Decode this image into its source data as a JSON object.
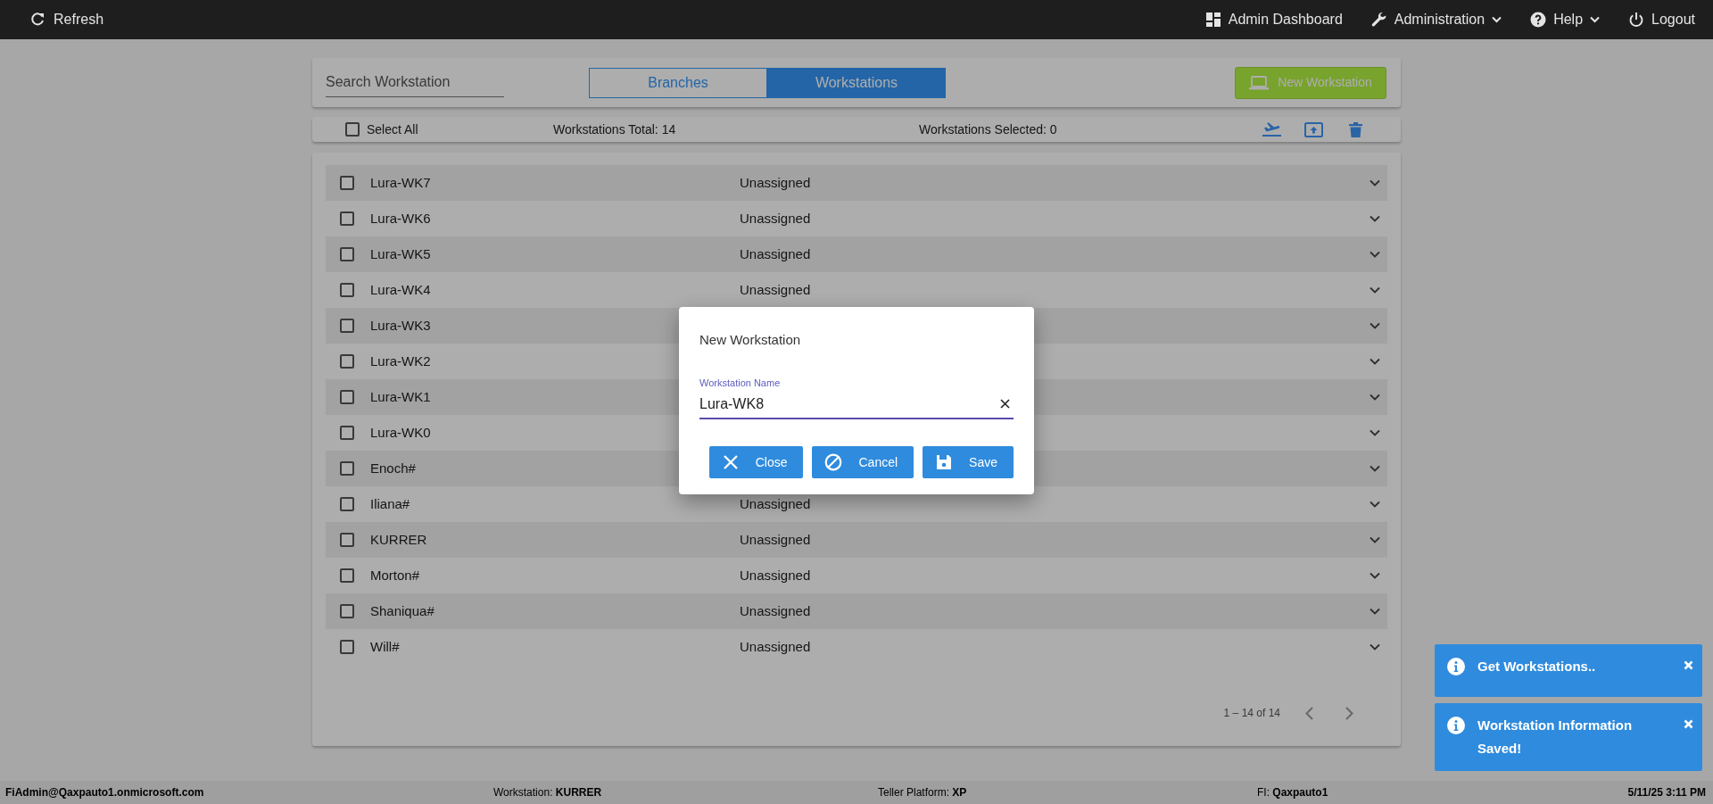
{
  "top_bar": {
    "left": [
      {
        "label": "Refresh",
        "kind": "refresh",
        "dropdown": false
      }
    ],
    "right": [
      {
        "label": "Admin Dashboard",
        "kind": "dashboard",
        "dropdown": false
      },
      {
        "label": "Administration",
        "kind": "wrench",
        "dropdown": true
      },
      {
        "label": "Help",
        "kind": "help",
        "dropdown": true
      },
      {
        "label": "Logout",
        "kind": "power",
        "dropdown": false
      }
    ]
  },
  "search": {
    "placeholder": "Search Workstation"
  },
  "tabs": [
    {
      "label": "Branches",
      "selected": false
    },
    {
      "label": "Workstations",
      "selected": true
    }
  ],
  "new_button": {
    "label": "New Workstation"
  },
  "toolbar": {
    "select_all": {
      "label": "Select All",
      "checked": false
    },
    "total": "Workstations Total: 14",
    "selected_count": "Workstations Selected: 0",
    "actions": [
      {
        "kind": "landing"
      },
      {
        "kind": "upload"
      },
      {
        "kind": "delete"
      }
    ]
  },
  "rows": [
    {
      "name": "Lura-WK7",
      "status": "Unassigned",
      "checked": false,
      "expanded": false
    },
    {
      "name": "Lura-WK6",
      "status": "Unassigned",
      "checked": false,
      "expanded": false
    },
    {
      "name": "Lura-WK5",
      "status": "Unassigned",
      "checked": false,
      "expanded": false
    },
    {
      "name": "Lura-WK4",
      "status": "Unassigned",
      "checked": false,
      "expanded": false
    },
    {
      "name": "Lura-WK3",
      "checked": false,
      "expanded": false
    },
    {
      "name": "Lura-WK2",
      "checked": false,
      "expanded": false
    },
    {
      "name": "Lura-WK1",
      "checked": false,
      "expanded": false
    },
    {
      "name": "Lura-WK0",
      "checked": false,
      "expanded": false
    },
    {
      "name": "Enoch#",
      "checked": false,
      "expanded": false
    },
    {
      "name": "Iliana#",
      "status": "Unassigned",
      "checked": false,
      "expanded": false
    },
    {
      "name": "KURRER",
      "status": "Unassigned",
      "checked": false,
      "expanded": false
    },
    {
      "name": "Morton#",
      "status": "Unassigned",
      "checked": false,
      "expanded": false
    },
    {
      "name": "Shaniqua#",
      "status": "Unassigned",
      "checked": false,
      "expanded": false
    },
    {
      "name": "Will#",
      "status": "Unassigned",
      "checked": false,
      "expanded": false
    }
  ],
  "pagination": {
    "range": "1 – 14 of 14",
    "prev_disabled": true,
    "next_disabled": true
  },
  "dialog": {
    "title": "New Workstation",
    "field": {
      "label": "Workstation Name",
      "value": "Lura-WK8"
    },
    "buttons": [
      {
        "label": "Close",
        "kind": "close"
      },
      {
        "label": "Cancel",
        "kind": "cancel"
      },
      {
        "label": "Save",
        "kind": "save"
      }
    ]
  },
  "toasts": [
    {
      "message": "Get Workstations.."
    },
    {
      "message": "Workstation Information Saved!"
    }
  ],
  "status_bar": {
    "user": "FiAdmin@Qaxpauto1.onmicrosoft.com",
    "workstation": "Workstation: **KURRER**",
    "platform": "Teller Platform: **XP**",
    "fi": "FI: **Qaxpauto1**",
    "datetime": "5/11/25 3:11 PM"
  }
}
